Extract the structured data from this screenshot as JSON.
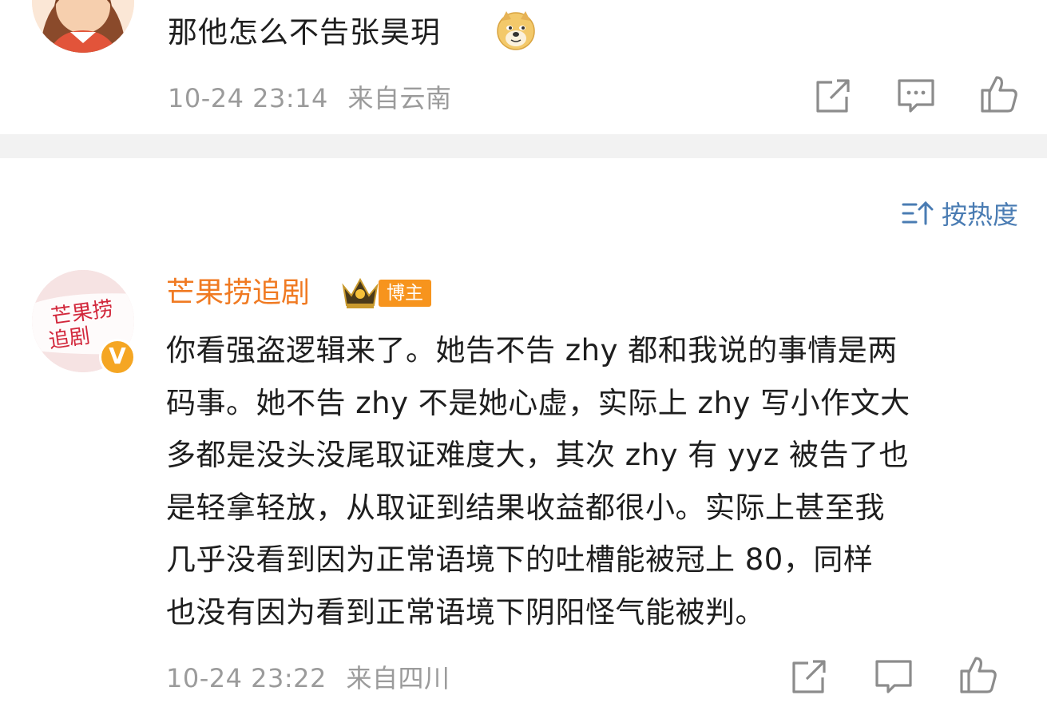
{
  "comment1": {
    "text": "那他怎么不告张昊玥",
    "emoji_icon": "doge-emoji",
    "time": "10-24 23:14",
    "location": "来自云南"
  },
  "sort": {
    "label": "按热度",
    "icon": "sort-icon"
  },
  "comment2": {
    "username": "芒果捞追剧",
    "badge": "博主",
    "avatar_text": "芒果捞追剧",
    "verified_mark": "V",
    "lines": [
      "你看强盗逻辑来了。她告不告 zhy 都和我说的事情是两",
      "码事。她不告 zhy 不是她心虚，实际上 zhy 写小作文大",
      "多都是没头没尾取证难度大，其次 zhy 有 yyz 被告了也",
      "是轻拿轻放，从取证到结果收益都很小。实际上甚至我",
      "几乎没看到因为正常语境下的吐槽能被冠上 80，同样",
      "也没有因为看到正常语境下阴阳怪气能被判。"
    ],
    "time": "10-24 23:22",
    "location": "来自四川"
  },
  "colors": {
    "username": "#f07a22",
    "badge": "#f7941d",
    "link_blue": "#4a7cb3",
    "meta_gray": "#9b9b9b",
    "divider": "#f2f2f2"
  }
}
